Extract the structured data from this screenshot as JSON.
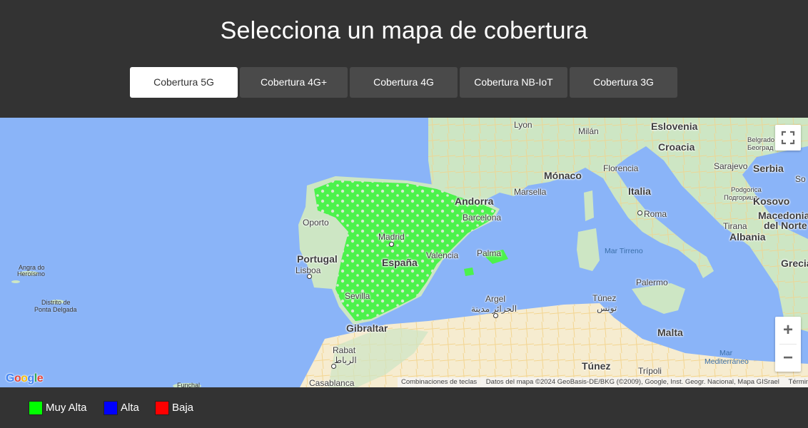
{
  "header": {
    "title": "Selecciona un mapa de cobertura"
  },
  "tabs": [
    {
      "label": "Cobertura 5G",
      "active": true
    },
    {
      "label": "Cobertura 4G+",
      "active": false
    },
    {
      "label": "Cobertura 4G",
      "active": false
    },
    {
      "label": "Cobertura NB-IoT",
      "active": false
    },
    {
      "label": "Cobertura 3G",
      "active": false
    }
  ],
  "map": {
    "labels": {
      "lyon": "Lyon",
      "milan": "Milán",
      "eslovenia": "Eslovenia",
      "croacia": "Croacia",
      "belgrado": "Belgrado",
      "belgrado_alt": "Београд",
      "monaco": "Mónaco",
      "florencia": "Florencia",
      "sarajevo": "Sarajevo",
      "serbia": "Serbia",
      "marsella": "Marsella",
      "italia": "Italia",
      "podgorica": "Podgorica",
      "podgorica_alt": "Подгорица",
      "kosovo": "Kosovo",
      "andorra": "Andorra",
      "barcelona": "Barcelona",
      "roma": "Roma",
      "macedonia": "Macedonia",
      "macedonia2": "del Norte",
      "tirana": "Tirana",
      "albania": "Albania",
      "oporto": "Oporto",
      "madrid": "Madrid",
      "portugal": "Portugal",
      "espana": "España",
      "valencia": "Valencia",
      "palma": "Palma",
      "mar_tirreno": "Mar Tirreno",
      "grecia": "Grecia",
      "lisboa": "Lisboa",
      "angra": "Angra do",
      "angra2": "Heroísmo",
      "palermo": "Palermo",
      "sevilla": "Sevilla",
      "argel": "Argel",
      "argel_ar": "الجزائر مدينة",
      "tunez_city": "Túnez",
      "tunez_city_ar": "تونس",
      "ponta": "Distrito de",
      "ponta2": "Ponta Delgada",
      "gibraltar": "Gibraltar",
      "malta": "Malta",
      "rabat": "Rabat",
      "rabat_ar": "الرباط",
      "mar_med": "Mar",
      "mar_med2": "Mediterráneo",
      "tunez_country": "Túnez",
      "tripoli": "Trípoli",
      "casablanca": "Casablanca",
      "funchal": "Funchal",
      "so": "So"
    },
    "controls": {
      "zoom_in": "+",
      "zoom_out": "−"
    },
    "attribution": {
      "shortcuts": "Combinaciones de teclas",
      "data": "Datos del mapa ©2024 GeoBasis-DE/BKG (©2009), Google, Inst. Geogr. Nacional, Mapa GISrael",
      "terms": "Términos"
    },
    "logo": "Google"
  },
  "legend": [
    {
      "label": "Muy Alta",
      "color": "#00ff00"
    },
    {
      "label": "Alta",
      "color": "#0000ff"
    },
    {
      "label": "Baja",
      "color": "#ff0000"
    }
  ]
}
